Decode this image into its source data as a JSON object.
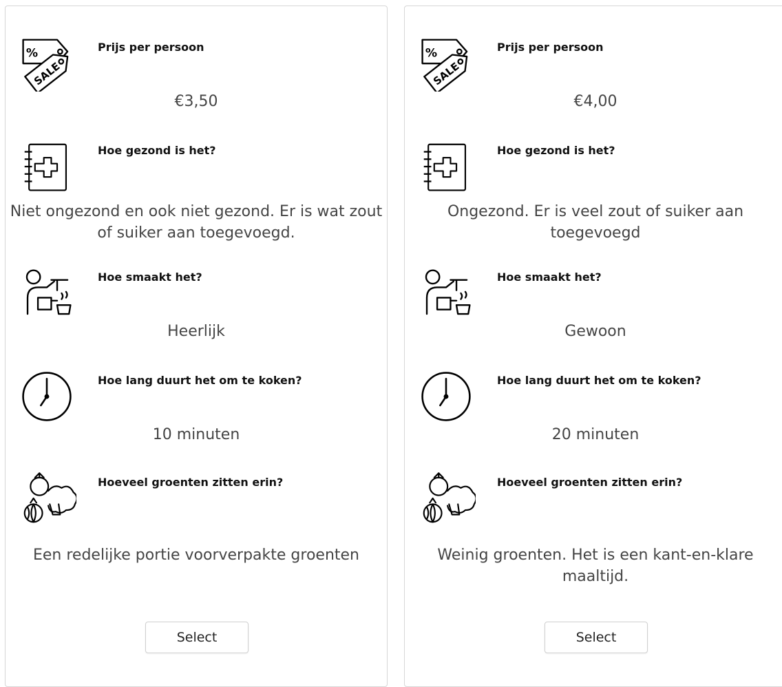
{
  "options": [
    {
      "price_question": "Prijs per persoon",
      "price_value": "€3,50",
      "health_question": "Hoe gezond is het?",
      "health_answer": "Niet ongezond en ook niet gezond. Er is wat zout of suiker aan toegevoegd.",
      "taste_question": "Hoe smaakt het?",
      "taste_answer": "Heerlijk",
      "time_question": "Hoe lang duurt het om te koken?",
      "time_answer": "10 minuten",
      "veg_question": "Hoeveel groenten zitten erin?",
      "veg_answer": "Een redelijke portie voorverpakte groenten",
      "select_label": "Select"
    },
    {
      "price_question": "Prijs per persoon",
      "price_value": "€4,00",
      "health_question": "Hoe gezond is het?",
      "health_answer": "Ongezond. Er is veel zout of suiker aan toegevoegd",
      "taste_question": "Hoe smaakt het?",
      "taste_answer": "Gewoon",
      "time_question": "Hoe lang duurt het om te koken?",
      "time_answer": "20 minuten",
      "veg_question": "Hoeveel groenten zitten erin?",
      "veg_answer": "Weinig groenten. Het is een kant-en-klare maaltijd.",
      "select_label": "Select"
    }
  ],
  "icons": {
    "price": "sale-tag-icon",
    "health": "medical-notebook-icon",
    "taste": "cook-icon",
    "time": "clock-icon",
    "veg": "vegetables-icon"
  }
}
